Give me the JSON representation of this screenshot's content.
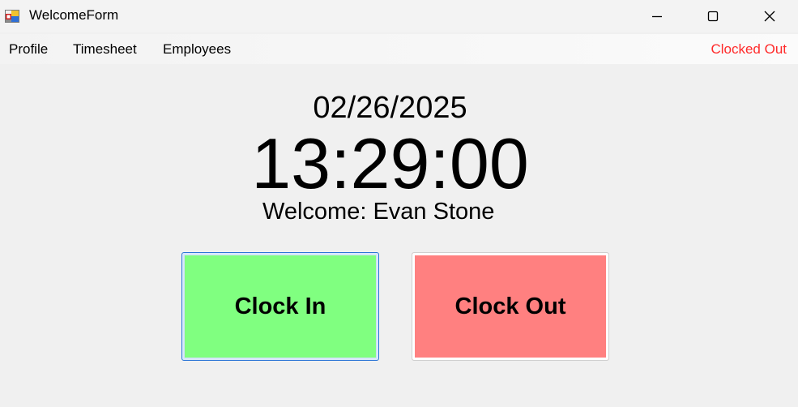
{
  "window": {
    "title": "WelcomeForm",
    "icon": "app-form-icon",
    "controls": {
      "minimize_icon": "minimize-icon",
      "maximize_icon": "maximize-icon",
      "close_icon": "close-icon"
    }
  },
  "menu": {
    "items": [
      {
        "label": "Profile"
      },
      {
        "label": "Timesheet"
      },
      {
        "label": "Employees"
      }
    ],
    "status": {
      "label": "Clocked Out",
      "color": "#ff2a2a"
    }
  },
  "main": {
    "date": "02/26/2025",
    "time": "13:29:00",
    "welcome_prefix": "Welcome:",
    "user_name": "Evan Stone"
  },
  "buttons": {
    "clock_in": {
      "label": "Clock In",
      "color": "#80ff80"
    },
    "clock_out": {
      "label": "Clock Out",
      "color": "#ff8080"
    }
  }
}
